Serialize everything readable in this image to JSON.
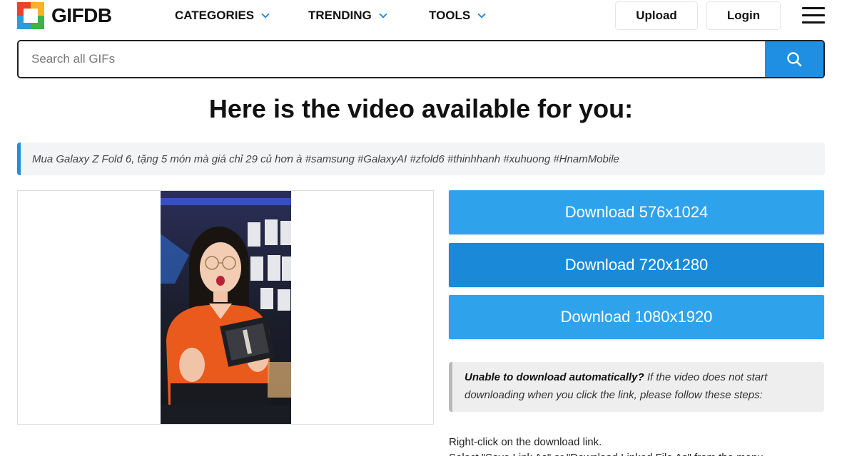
{
  "header": {
    "logo_text": "GIFDB",
    "logo_colors": [
      "#e8412c",
      "#f6b32a",
      "#2e9cdb",
      "#3bb24a"
    ],
    "nav": [
      {
        "label": "CATEGORIES"
      },
      {
        "label": "TRENDING"
      },
      {
        "label": "TOOLS"
      }
    ],
    "upload_label": "Upload",
    "login_label": "Login",
    "menu_icon": "hamburger-icon"
  },
  "search": {
    "placeholder": "Search all GIFs",
    "value": "",
    "button_icon": "search-icon"
  },
  "main": {
    "title": "Here is the video available for you:",
    "caption": "Mua Galaxy Z Fold 6, tặng 5 món mà giá chỉ 29 củ hơn à #samsung #GalaxyAI #zfold6 #thinhhanh #xuhuong #HnamMobile"
  },
  "downloads": [
    {
      "label": "Download 576x1024"
    },
    {
      "label": "Download 720x1280"
    },
    {
      "label": "Download 1080x1920"
    }
  ],
  "notice": {
    "bold": "Unable to download automatically?",
    "text": " If the video does not start downloading when you click the link, please follow these steps:"
  },
  "steps": [
    "Right-click on the download link.",
    "Select \"Save Link As\" or \"Download Linked File As\" from the menu."
  ],
  "colors": {
    "accent": "#1e8fe3",
    "download_primary": "#2ea3ec",
    "download_hover": "#1a8ad8",
    "caption_bar": "#1e8fe3"
  }
}
